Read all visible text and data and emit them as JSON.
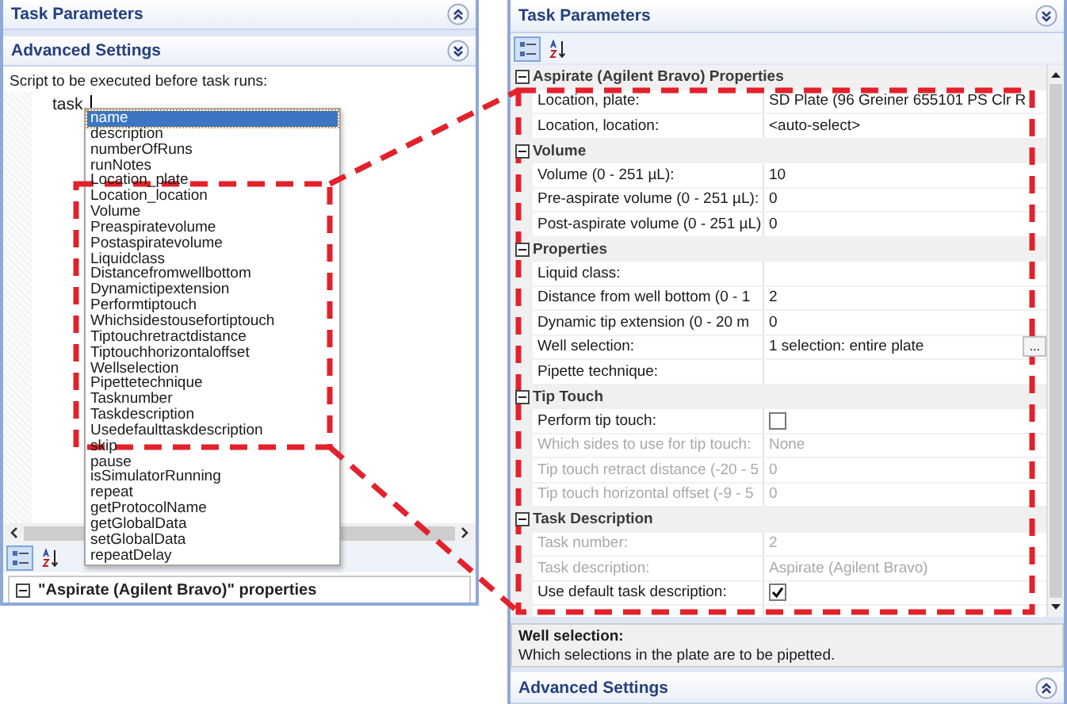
{
  "left_panel": {
    "sections": [
      {
        "title": "Task Parameters",
        "expanded": false
      },
      {
        "title": "Advanced Settings",
        "expanded": true
      }
    ],
    "script_label": "Script to be executed before task runs:",
    "script_text": "task.",
    "autocomplete": [
      {
        "label": "name",
        "selected": true
      },
      {
        "label": "description",
        "selected": false
      },
      {
        "label": "numberOfRuns",
        "selected": false
      },
      {
        "label": "runNotes",
        "selected": false
      },
      {
        "label": "Location_plate",
        "selected": false
      },
      {
        "label": "Location_location",
        "selected": false
      },
      {
        "label": "Volume",
        "selected": false
      },
      {
        "label": "Preaspiratevolume",
        "selected": false
      },
      {
        "label": "Postaspiratevolume",
        "selected": false
      },
      {
        "label": "Liquidclass",
        "selected": false
      },
      {
        "label": "Distancefromwellbottom",
        "selected": false
      },
      {
        "label": "Dynamictipextension",
        "selected": false
      },
      {
        "label": "Performtiptouch",
        "selected": false
      },
      {
        "label": "Whichsidestousefortiptouch",
        "selected": false
      },
      {
        "label": "Tiptouchretractdistance",
        "selected": false
      },
      {
        "label": "Tiptouchhorizontaloffset",
        "selected": false
      },
      {
        "label": "Wellselection",
        "selected": false
      },
      {
        "label": "Pipettetechnique",
        "selected": false
      },
      {
        "label": "Tasknumber",
        "selected": false
      },
      {
        "label": "Taskdescription",
        "selected": false
      },
      {
        "label": "Usedefaulttaskdescription",
        "selected": false
      },
      {
        "label": "skip",
        "selected": false
      },
      {
        "label": "pause",
        "selected": false
      },
      {
        "label": "isSimulatorRunning",
        "selected": false
      },
      {
        "label": "repeat",
        "selected": false
      },
      {
        "label": "getProtocolName",
        "selected": false
      },
      {
        "label": "getGlobalData",
        "selected": false
      },
      {
        "label": "setGlobalData",
        "selected": false
      },
      {
        "label": "repeatDelay",
        "selected": false
      }
    ],
    "toolbar": [
      {
        "kind": "categorized",
        "selected": true
      },
      {
        "kind": "alphabetical",
        "selected": false
      }
    ],
    "property_category": "\"Aspirate (Agilent Bravo)\" properties"
  },
  "right_panel": {
    "header": {
      "title": "Task Parameters",
      "expanded": true
    },
    "toolbar": [
      {
        "kind": "categorized",
        "selected": true
      },
      {
        "kind": "alphabetical",
        "selected": false
      }
    ],
    "categories": [
      {
        "title": "Aspirate (Agilent Bravo) Properties",
        "expanded": true,
        "rows": [
          {
            "label": "Location, plate:",
            "value": "SD Plate (96 Greiner 655101 PS Clr R",
            "kind": "text",
            "disabled": false
          },
          {
            "label": "Location, location:",
            "value": "<auto-select>",
            "kind": "text",
            "disabled": false
          }
        ]
      },
      {
        "title": "Volume",
        "expanded": true,
        "rows": [
          {
            "label": "Volume (0 - 251 µL):",
            "value": "10",
            "kind": "text",
            "disabled": false
          },
          {
            "label": "Pre-aspirate volume (0 - 251 µL):",
            "value": "0",
            "kind": "text",
            "disabled": false
          },
          {
            "label": "Post-aspirate volume (0 - 251 µL)",
            "value": "0",
            "kind": "text",
            "disabled": false
          }
        ]
      },
      {
        "title": "Properties",
        "expanded": true,
        "rows": [
          {
            "label": "Liquid class:",
            "kind": "text",
            "disabled": false
          },
          {
            "label": "Distance from well bottom (0 - 1",
            "value": "2",
            "kind": "text",
            "disabled": false
          },
          {
            "label": "Dynamic tip extension (0 - 20 m",
            "value": "0",
            "kind": "text",
            "disabled": false
          },
          {
            "label": "Well selection:",
            "value": "1 selection: entire plate",
            "kind": "button",
            "button_label": "...",
            "disabled": false
          },
          {
            "label": "Pipette technique:",
            "kind": "text",
            "disabled": false
          }
        ]
      },
      {
        "title": "Tip Touch",
        "expanded": true,
        "rows": [
          {
            "label": "Perform tip touch:",
            "kind": "checkbox",
            "checked": false,
            "disabled": false
          },
          {
            "label": "Which sides to use for tip touch:",
            "value": "None",
            "kind": "text",
            "disabled": true
          },
          {
            "label": "Tip touch retract distance (-20 - 5",
            "value": "0",
            "kind": "text",
            "disabled": true
          },
          {
            "label": "Tip touch horizontal offset (-9 - 5",
            "value": "0",
            "kind": "text",
            "disabled": true
          }
        ]
      },
      {
        "title": "Task Description",
        "expanded": true,
        "rows": [
          {
            "label": "Task number:",
            "value": "2",
            "kind": "text",
            "disabled": true
          },
          {
            "label": "Task description:",
            "value": "Aspirate (Agilent Bravo)",
            "kind": "text",
            "disabled": true
          },
          {
            "label": "Use default task description:",
            "kind": "checkbox",
            "checked": true,
            "disabled": false
          }
        ]
      }
    ],
    "description": {
      "title": "Well selection:",
      "text": "Which selections in the plate are to be pipetted."
    },
    "footer": {
      "title": "Advanced Settings",
      "expanded": false
    }
  }
}
